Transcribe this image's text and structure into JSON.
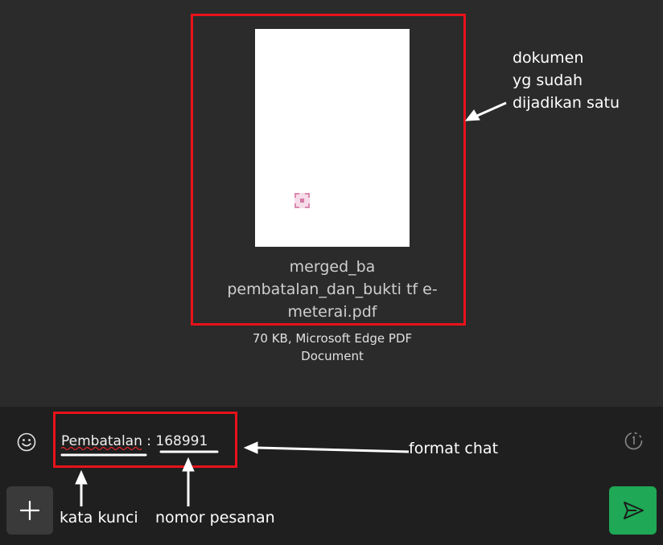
{
  "document": {
    "filename_lines": [
      "merged_ba",
      "pembatalan_dan_bukti tf e-",
      "meterai.pdf"
    ],
    "meta_lines": [
      "70 KB, Microsoft Edge PDF",
      "Document"
    ]
  },
  "annotations": {
    "document_note_lines": [
      "dokumen",
      "yg sudah",
      "dijadikan satu"
    ],
    "format_chat": "format chat",
    "kata_kunci": "kata kunci",
    "nomor_pesanan": "nomor pesanan"
  },
  "composer": {
    "message": {
      "keyword": "Pembatalan",
      "separator": " : ",
      "order_number": "168991"
    },
    "emoji_icon": "smiley-icon",
    "timer_icon": "timer-icon",
    "add_icon": "plus-icon",
    "send_icon": "send-icon",
    "send_color": "#1fa855"
  },
  "highlight_color": "#e8121a"
}
